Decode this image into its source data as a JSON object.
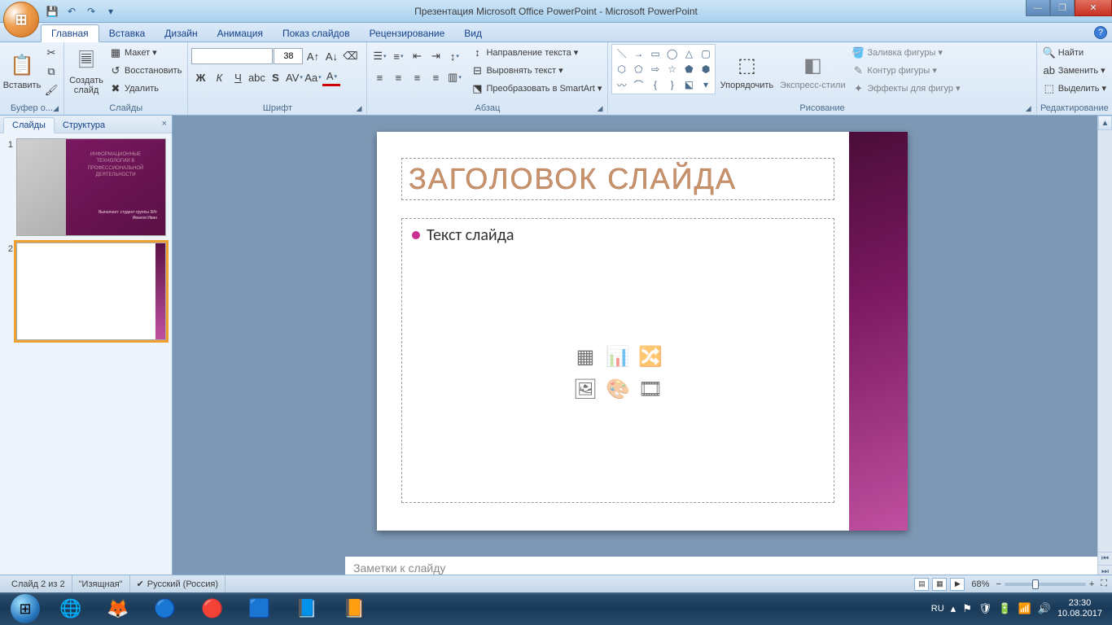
{
  "window": {
    "title": "Презентация Microsoft Office PowerPoint - Microsoft PowerPoint"
  },
  "tabs": {
    "home": "Главная",
    "insert": "Вставка",
    "design": "Дизайн",
    "animation": "Анимация",
    "slideshow": "Показ слайдов",
    "review": "Рецензирование",
    "view": "Вид"
  },
  "ribbon": {
    "clipboard": {
      "label": "Буфер о...",
      "paste": "Вставить"
    },
    "slides": {
      "label": "Слайды",
      "new_slide": "Создать\nслайд",
      "layout": "Макет",
      "reset": "Восстановить",
      "delete": "Удалить"
    },
    "font": {
      "label": "Шрифт",
      "font_name": "",
      "font_size": "38"
    },
    "paragraph": {
      "label": "Абзац",
      "direction": "Направление текста",
      "align": "Выровнять текст",
      "smartart": "Преобразовать в SmartArt"
    },
    "drawing": {
      "label": "Рисование",
      "arrange": "Упорядочить",
      "styles": "Экспресс-стили",
      "fill": "Заливка фигуры",
      "outline": "Контур фигуры",
      "effects": "Эффекты для фигур"
    },
    "editing": {
      "label": "Редактирование",
      "find": "Найти",
      "replace": "Заменить",
      "select": "Выделить"
    }
  },
  "panel": {
    "slides_tab": "Слайды",
    "outline_tab": "Структура",
    "thumb1": {
      "title": "ИНФОРМАЦИОННЫЕ\nТЕХНОЛОГИИ В\nПРОФЕССИОНАЛЬНОЙ\nДЕЯТЕЛЬНОСТИ",
      "sub": "Выполнил: студент группы 3Ит\nИванов Иван"
    }
  },
  "slide": {
    "title_placeholder": "Заголовок слайда",
    "content_placeholder": "Текст слайда"
  },
  "notes": {
    "placeholder": "Заметки к слайду"
  },
  "status": {
    "slide_count": "Слайд 2 из 2",
    "theme": "\"Изящная\"",
    "language": "Русский (Россия)",
    "zoom": "68%"
  },
  "tray": {
    "lang": "RU",
    "time": "23:30",
    "date": "10.08.2017"
  }
}
